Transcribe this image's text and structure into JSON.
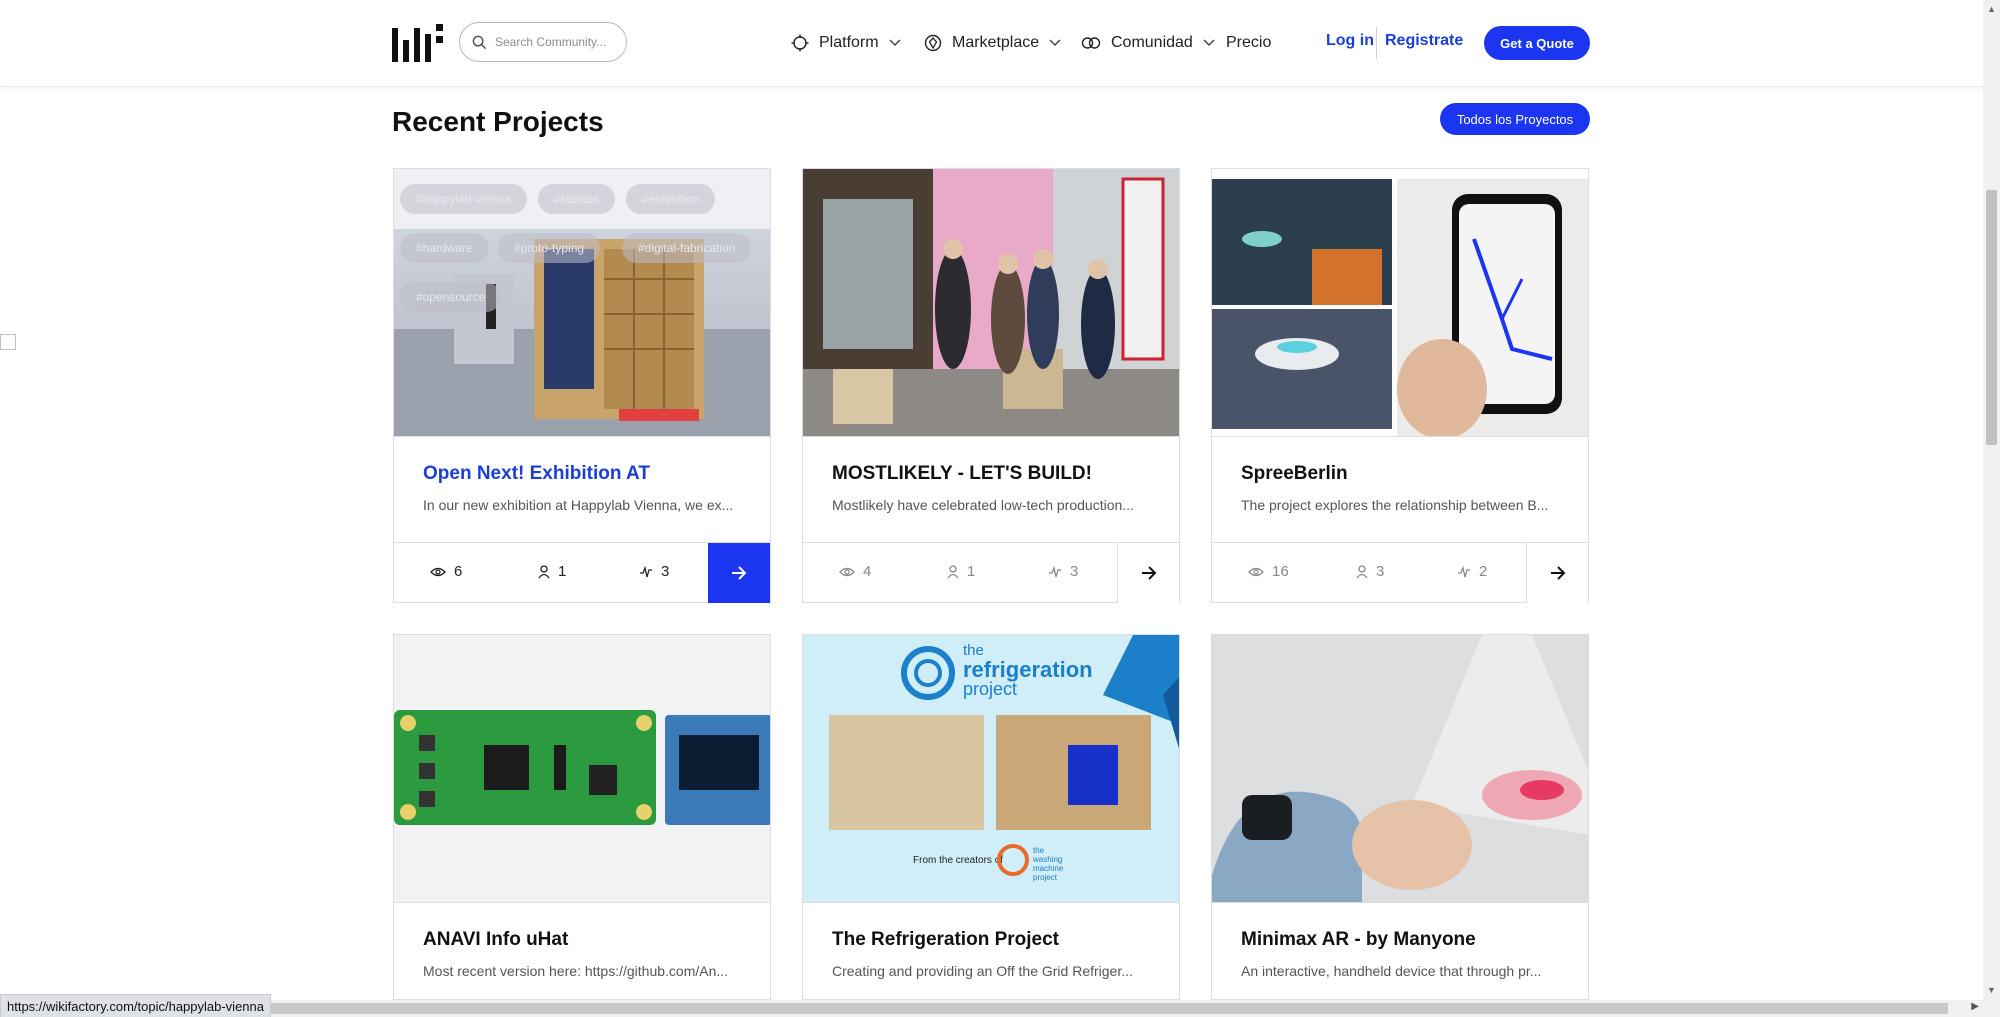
{
  "header": {
    "search_placeholder": "Search Community...",
    "nav": [
      {
        "label": "Platform",
        "icon": "compass-icon"
      },
      {
        "label": "Marketplace",
        "icon": "hexagon-icon"
      },
      {
        "label": "Comunidad",
        "icon": "link-icon"
      },
      {
        "label": "Precio"
      }
    ],
    "login": "Log in",
    "register": "Registrate",
    "quote": "Get a Quote"
  },
  "section": {
    "title": "Recent Projects",
    "all_projects": "Todos los Proyectos"
  },
  "projects": [
    {
      "title": "Open Next! Exhibition AT",
      "description": "In our new exhibition at Happylab Vienna, we ex...",
      "views": "6",
      "members": "1",
      "activity": "3",
      "tags": [
        "#happylab-vienna",
        "#fablabs",
        "#exhibition",
        "#hardware",
        "#proto-typing",
        "#digital-fabrication",
        "#opensource"
      ]
    },
    {
      "title": "MOSTLIKELY - LET'S BUILD!",
      "description": "Mostlikely have celebrated low-tech production...",
      "views": "4",
      "members": "1",
      "activity": "3"
    },
    {
      "title": "SpreeBerlin",
      "description": "The project explores the relationship between B...",
      "views": "16",
      "members": "3",
      "activity": "2"
    },
    {
      "title": "ANAVI Info uHat",
      "description": "Most recent version here: https://github.com/An..."
    },
    {
      "title": "The Refrigeration Project",
      "description": "Creating and providing an Off the Grid Refriger...",
      "image_text": {
        "brand_line1": "the",
        "brand_line2": "refrigeration",
        "brand_line3": "project",
        "footer": "From the creators of",
        "partner1": "the",
        "partner2": "washing",
        "partner3": "machine",
        "partner4": "project"
      }
    },
    {
      "title": "Minimax AR - by Manyone",
      "description": "An interactive, handheld device that through pr..."
    }
  ],
  "status_bar": {
    "url": "https://wikifactory.com/topic/happylab-vienna"
  },
  "colors": {
    "accent": "#1b35f0",
    "link": "#1b3fd6"
  }
}
